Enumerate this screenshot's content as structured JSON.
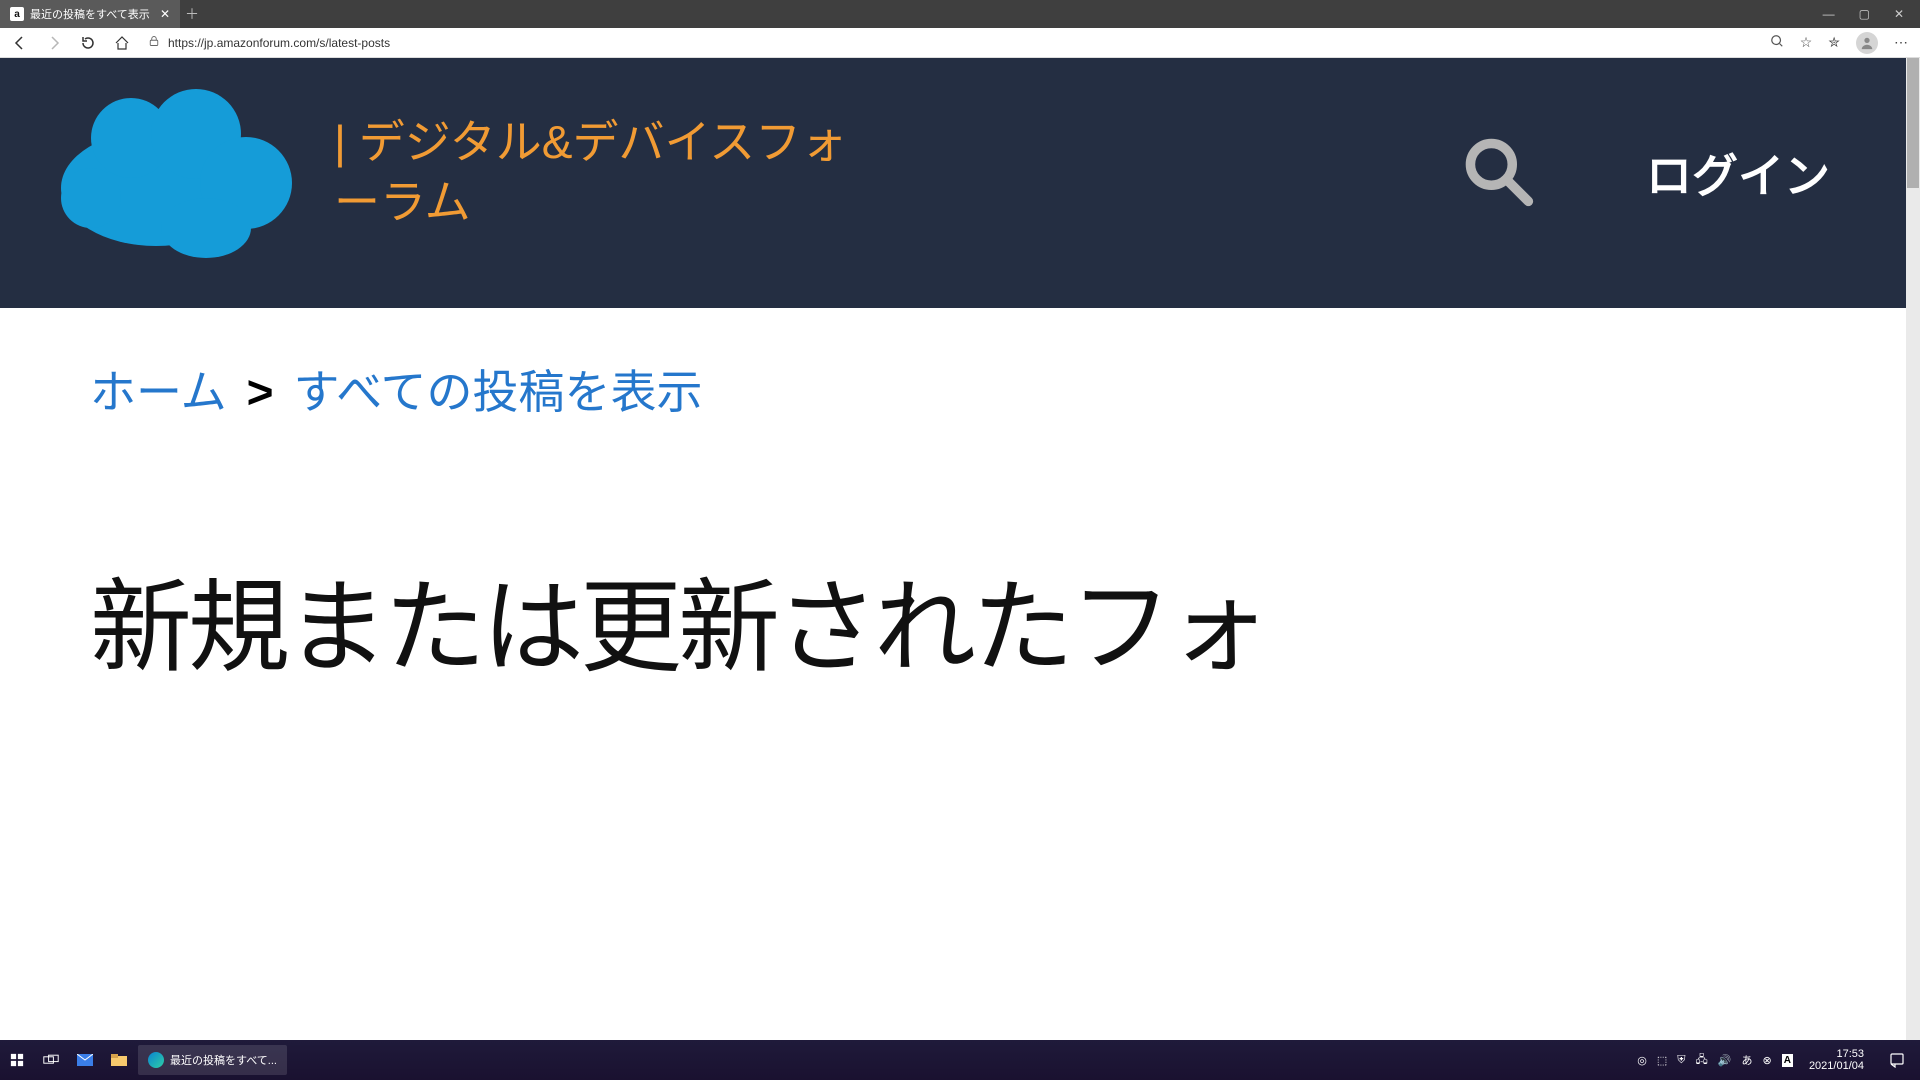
{
  "browser": {
    "tab_title": "最近の投稿をすべて表示",
    "url_display": "https://jp.amazonforum.com/s/latest-posts"
  },
  "header": {
    "site_title": "| デジタル&デバイスフォーラム",
    "login_label": "ログイン"
  },
  "breadcrumb": {
    "home": "ホーム",
    "separator": ">",
    "current": "すべての投稿を表示"
  },
  "main": {
    "heading": "新規または更新されたフォ"
  },
  "taskbar": {
    "active_app": "最近の投稿をすべて...",
    "time": "17:53",
    "date": "2021/01/04"
  }
}
